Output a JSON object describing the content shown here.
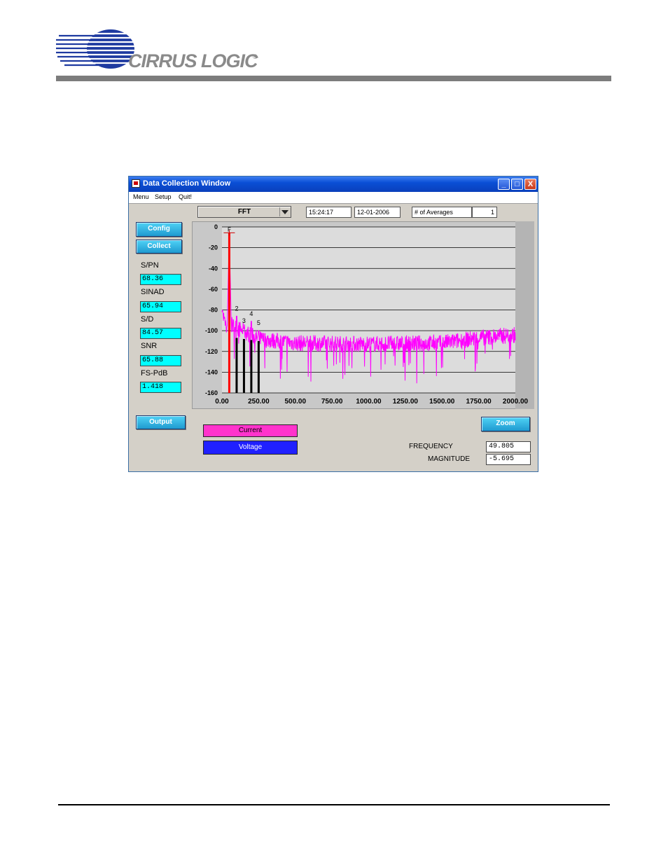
{
  "brand": {
    "name": "CIRRUS LOGIC",
    "reg": "®"
  },
  "window": {
    "title": "Data Collection Window",
    "menu": [
      "Menu",
      "Setup",
      "Quit!"
    ],
    "controls": {
      "minimize": "_",
      "maximize": "□",
      "close": "X"
    }
  },
  "toolbar": {
    "mode": "FFT",
    "time": "15:24:17",
    "date": "12-01-2006",
    "averages_label": "# of Averages",
    "averages_value": "1"
  },
  "buttons": {
    "config": "Config",
    "collect": "Collect",
    "output": "Output",
    "zoom": "Zoom"
  },
  "metrics": [
    {
      "label": "S/PN",
      "value": "68.36"
    },
    {
      "label": "SINAD",
      "value": "65.94"
    },
    {
      "label": "S/D",
      "value": "84.57"
    },
    {
      "label": "SNR",
      "value": "65.88"
    },
    {
      "label": "FS-PdB",
      "value": "1.418"
    }
  ],
  "legend": {
    "current": "Current",
    "voltage": "Voltage"
  },
  "readout": {
    "frequency_label": "FREQUENCY",
    "frequency_value": "49.805",
    "magnitude_label": "MAGNITUDE",
    "magnitude_value": "-5.695"
  },
  "colors": {
    "trace": "#ff00ff",
    "fundamental": "#ff0000",
    "harmonics": "#000000",
    "plot_bg": "#dcdcdc"
  },
  "chart_data": {
    "type": "line",
    "xlim": [
      0,
      2000
    ],
    "ylim": [
      -160,
      0
    ],
    "x_ticks": [
      "0.00",
      "250.00",
      "500.00",
      "750.00",
      "1000.00",
      "1250.00",
      "1500.00",
      "1750.00",
      "2000.00"
    ],
    "y_ticks": [
      "0",
      "-20",
      "-40",
      "-60",
      "-80",
      "-100",
      "-120",
      "-140",
      "-160"
    ],
    "grid": true,
    "fundamental": {
      "label": "F",
      "x": 49.805,
      "y": -5.695
    },
    "harmonics": [
      {
        "label": "2",
        "x": 100,
        "y": -82
      },
      {
        "label": "3",
        "x": 150,
        "y": -94
      },
      {
        "label": "4",
        "x": 200,
        "y": -87
      },
      {
        "label": "5",
        "x": 250,
        "y": -96
      }
    ],
    "spectrum_floor": {
      "x": [
        0,
        250,
        500,
        1000,
        1500,
        1750,
        2000
      ],
      "y": [
        -90,
        -108,
        -112,
        -113,
        -112,
        -107,
        -104
      ]
    }
  }
}
